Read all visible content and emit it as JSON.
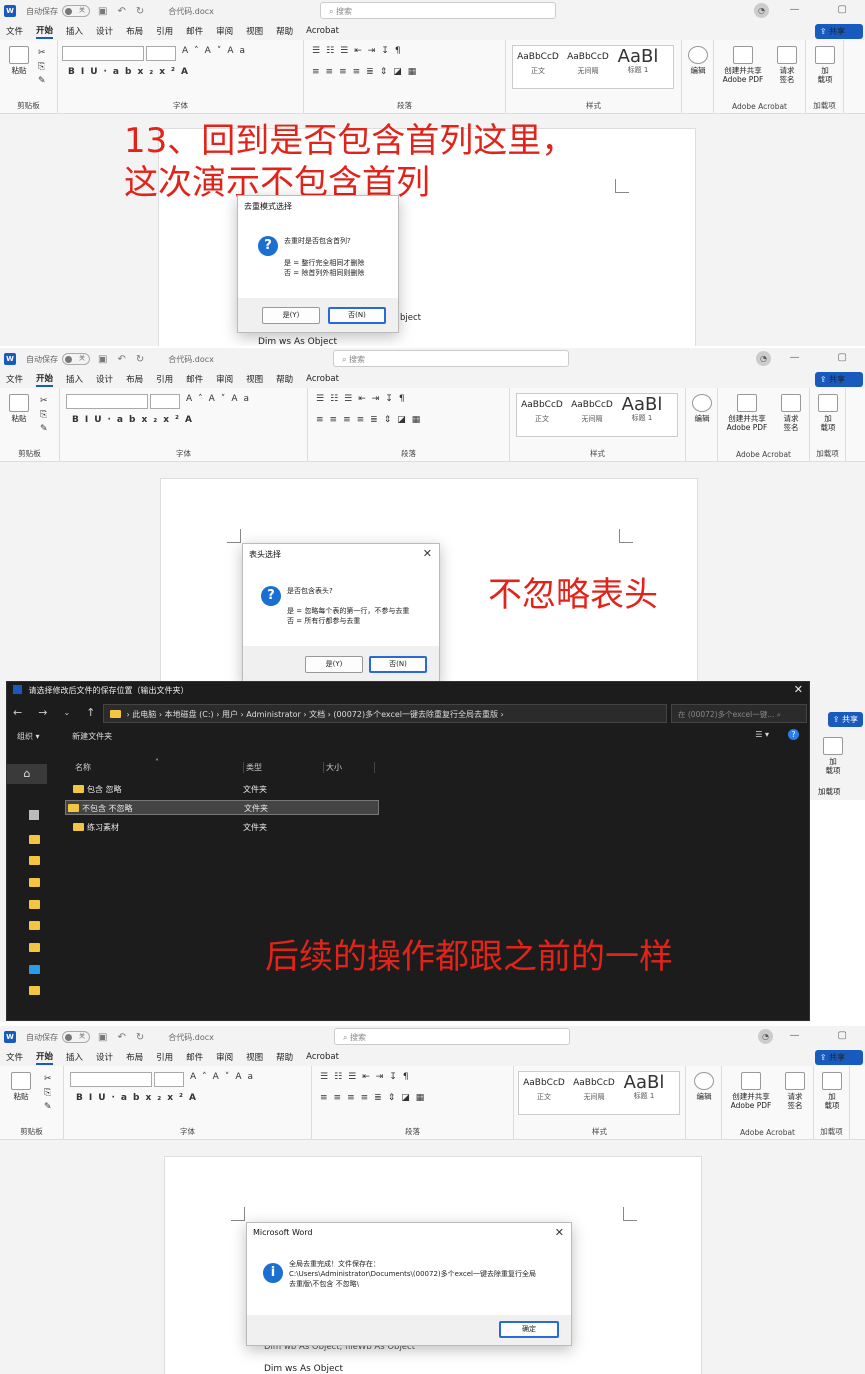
{
  "word": {
    "autosave": "自动保存",
    "toggle_off": "关",
    "doc_name": "合代码.docx",
    "search_placeholder": "搜索",
    "tabs": [
      "文件",
      "开始",
      "插入",
      "设计",
      "布局",
      "引用",
      "邮件",
      "审阅",
      "视图",
      "帮助",
      "Acrobat"
    ],
    "share": "共享",
    "paste": "粘贴",
    "clipboard": "剪贴板",
    "font": "字体",
    "paragraph": "段落",
    "styles_group": "样式",
    "style_items": [
      {
        "sample": "AaBbCcD",
        "name": "正文"
      },
      {
        "sample": "AaBbCcD",
        "name": "无间隔"
      },
      {
        "sample": "AaBl",
        "name": "标题 1"
      }
    ],
    "edit": "编辑",
    "create_pdf": "创建并共享\nAdobe PDF",
    "request_sign": "请求\n签名",
    "adobe_acrobat": "Adobe Acrobat",
    "addin": "加\n载项",
    "addin_group": "加载项"
  },
  "panel1": {
    "annotation": "13、回到是否包含首列这里，\n这次演示不包含首列",
    "dialog_title": "去重模式选择",
    "question": "去重时是否包含首列?",
    "detail": "是 = 整行完全相同才删除\n否 = 除首列外相同则删除",
    "yes": "是(Y)",
    "no": "否(N)",
    "doc_line": "bject"
  },
  "panel2": {
    "doc_line_top": "Dim ws As Object",
    "dialog_title": "表头选择",
    "question": "是否包含表头?",
    "detail": "是 = 忽略每个表的第一行，不参与去重\n否 = 所有行都参与去重",
    "yes": "是(Y)",
    "no": "否(N)",
    "annotation": "不忽略表头"
  },
  "explorer": {
    "title": "请选择修改后文件的保存位置（输出文件夹）",
    "breadcrumb": [
      "此电脑",
      "本地磁盘 (C:)",
      "用户",
      "Administrator",
      "文档",
      "(00072)多个excel一键去除重复行全局去重版"
    ],
    "search": "在 (00072)多个excel一键...",
    "organize": "组织",
    "new_folder": "新建文件夹",
    "columns": [
      "名称",
      "类型",
      "大小"
    ],
    "rows": [
      {
        "name": "包含 忽略",
        "type": "文件夹"
      },
      {
        "name": "不包含 不忽略",
        "type": "文件夹"
      },
      {
        "name": "练习素材",
        "type": "文件夹"
      }
    ],
    "annotation": "后续的操作都跟之前的一样"
  },
  "panel4": {
    "dialog_title": "Microsoft Word",
    "message": "全局去重完成！文件保存在：\nC:\\Users\\Administrator\\Documents\\(00072)多个excel一键去除重复行全局\n去重版\\不包含 不忽略\\",
    "ok": "确定",
    "doc_line1": "Dim wb As Object, fileWb As Object",
    "doc_line2": "Dim ws As Object"
  }
}
